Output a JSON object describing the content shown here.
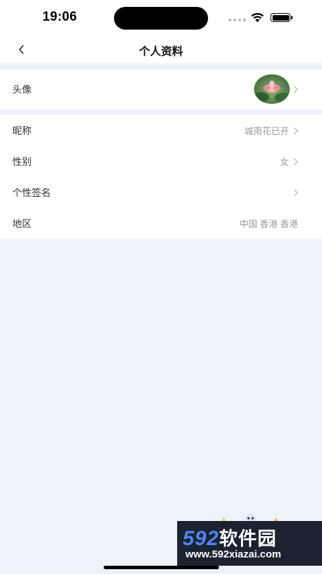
{
  "status_bar": {
    "time": "19:06",
    "icons": [
      "cellular-signal-icon",
      "wifi-icon",
      "battery-icon"
    ]
  },
  "nav": {
    "title": "个人资料",
    "back_icon": "chevron-left-icon"
  },
  "profile": {
    "avatar": {
      "label": "头像",
      "image": "lotus-flower-avatar"
    },
    "fields": [
      {
        "label": "昵称",
        "value": "城南花已开",
        "has_chevron": true
      },
      {
        "label": "性别",
        "value": "女",
        "has_chevron": true
      },
      {
        "label": "个性签名",
        "value": "",
        "has_chevron": true
      },
      {
        "label": "地区",
        "value": "中国 香港 香港",
        "has_chevron": false
      }
    ]
  },
  "watermark": {
    "line1_number": "592",
    "line1_text": "软件园",
    "line2": "www.592xiazai.com"
  },
  "colors": {
    "background": "#eef3fa",
    "card": "#ffffff",
    "label": "#333333",
    "value": "#9a9a9a",
    "watermark_accent": "#4a86ff"
  }
}
